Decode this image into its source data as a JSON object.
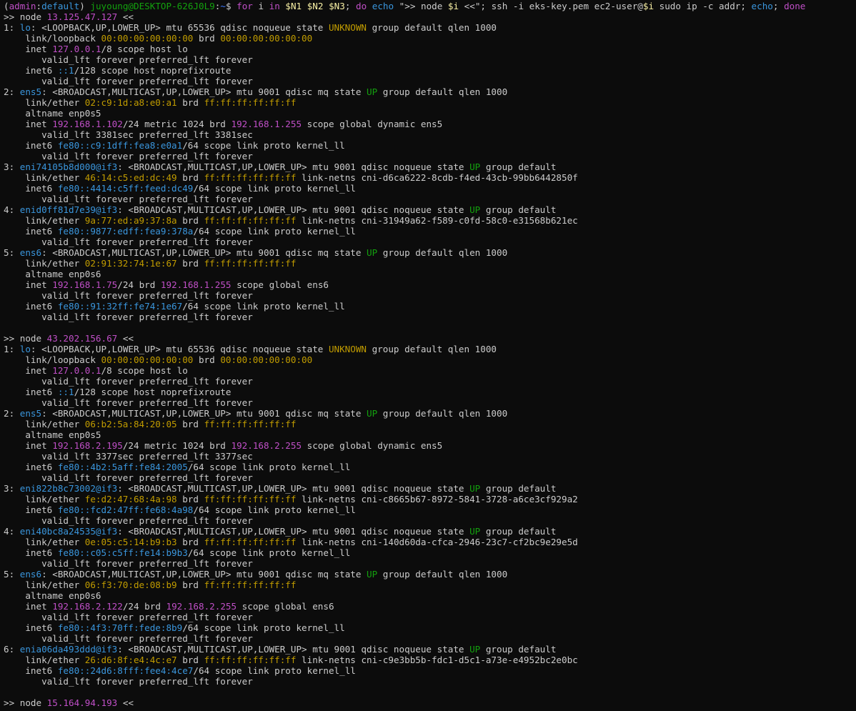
{
  "terminal": {
    "colors": {
      "background": "#0c0c0c",
      "text": "#cccccc",
      "cyan": "#3a96dd",
      "magenta": "#c04fc7",
      "yellow": "#c19c00",
      "green": "#13a10e",
      "bright_green": "#16c60c",
      "bright_blue": "#3b78ff",
      "bright_yellow": "#f9f1a5"
    },
    "lines": [
      [
        {
          "t": "(",
          "c": "text"
        },
        {
          "t": "admin",
          "c": "magenta"
        },
        {
          "t": ":",
          "c": "text"
        },
        {
          "t": "default",
          "c": "cyan"
        },
        {
          "t": ") ",
          "c": "text"
        },
        {
          "t": "juyoung@DESKTOP-626J0L9",
          "c": "green"
        },
        {
          "t": ":",
          "c": "text"
        },
        {
          "t": "~",
          "c": "bright_blue"
        },
        {
          "t": "$ ",
          "c": "text"
        },
        {
          "t": "for",
          "c": "magenta"
        },
        {
          "t": " i ",
          "c": "text"
        },
        {
          "t": "in",
          "c": "magenta"
        },
        {
          "t": " ",
          "c": "text"
        },
        {
          "t": "$N1",
          "c": "bright_yellow"
        },
        {
          "t": " ",
          "c": "text"
        },
        {
          "t": "$N2",
          "c": "bright_yellow"
        },
        {
          "t": " ",
          "c": "text"
        },
        {
          "t": "$N3",
          "c": "bright_yellow"
        },
        {
          "t": "; ",
          "c": "text"
        },
        {
          "t": "do",
          "c": "magenta"
        },
        {
          "t": " ",
          "c": "text"
        },
        {
          "t": "echo",
          "c": "cyan"
        },
        {
          "t": " \">> node ",
          "c": "text"
        },
        {
          "t": "$i",
          "c": "bright_yellow"
        },
        {
          "t": " <<\"; ssh -i eks-key.pem ec2-user@",
          "c": "text"
        },
        {
          "t": "$i",
          "c": "bright_yellow"
        },
        {
          "t": " sudo ip -c addr; ",
          "c": "text"
        },
        {
          "t": "echo",
          "c": "cyan"
        },
        {
          "t": "; ",
          "c": "text"
        },
        {
          "t": "done",
          "c": "magenta"
        }
      ],
      [
        {
          "t": ">> node ",
          "c": "text"
        },
        {
          "t": "13.125.47.127",
          "c": "magenta"
        },
        {
          "t": " <<",
          "c": "text"
        }
      ],
      [
        {
          "t": "1: ",
          "c": "text"
        },
        {
          "t": "lo",
          "c": "cyan"
        },
        {
          "t": ": <LOOPBACK,UP,LOWER_UP> mtu 65536 qdisc noqueue state ",
          "c": "text"
        },
        {
          "t": "UNKNOWN",
          "c": "yellow"
        },
        {
          "t": " group default qlen 1000",
          "c": "text"
        }
      ],
      [
        {
          "t": "    link/loopback ",
          "c": "text"
        },
        {
          "t": "00:00:00:00:00:00",
          "c": "yellow"
        },
        {
          "t": " brd ",
          "c": "text"
        },
        {
          "t": "00:00:00:00:00:00",
          "c": "yellow"
        }
      ],
      [
        {
          "t": "    inet ",
          "c": "text"
        },
        {
          "t": "127.0.0.1",
          "c": "magenta"
        },
        {
          "t": "/8 scope host lo",
          "c": "text"
        }
      ],
      [
        {
          "t": "       valid_lft forever preferred_lft forever",
          "c": "text"
        }
      ],
      [
        {
          "t": "    inet6 ",
          "c": "text"
        },
        {
          "t": "::1",
          "c": "cyan"
        },
        {
          "t": "/128 scope host noprefixroute",
          "c": "text"
        }
      ],
      [
        {
          "t": "       valid_lft forever preferred_lft forever",
          "c": "text"
        }
      ],
      [
        {
          "t": "2: ",
          "c": "text"
        },
        {
          "t": "ens5",
          "c": "cyan"
        },
        {
          "t": ": <BROADCAST,MULTICAST,UP,LOWER_UP> mtu 9001 qdisc mq state ",
          "c": "text"
        },
        {
          "t": "UP",
          "c": "green"
        },
        {
          "t": " group default qlen 1000",
          "c": "text"
        }
      ],
      [
        {
          "t": "    link/ether ",
          "c": "text"
        },
        {
          "t": "02:c9:1d:a8:e0:a1",
          "c": "yellow"
        },
        {
          "t": " brd ",
          "c": "text"
        },
        {
          "t": "ff:ff:ff:ff:ff:ff",
          "c": "yellow"
        }
      ],
      [
        {
          "t": "    altname enp0s5",
          "c": "text"
        }
      ],
      [
        {
          "t": "    inet ",
          "c": "text"
        },
        {
          "t": "192.168.1.102",
          "c": "magenta"
        },
        {
          "t": "/24 metric 1024 brd ",
          "c": "text"
        },
        {
          "t": "192.168.1.255",
          "c": "magenta"
        },
        {
          "t": " scope global dynamic ens5",
          "c": "text"
        }
      ],
      [
        {
          "t": "       valid_lft 3381sec preferred_lft 3381sec",
          "c": "text"
        }
      ],
      [
        {
          "t": "    inet6 ",
          "c": "text"
        },
        {
          "t": "fe80::c9:1dff:fea8:e0a1",
          "c": "cyan"
        },
        {
          "t": "/64 scope link proto kernel_ll",
          "c": "text"
        }
      ],
      [
        {
          "t": "       valid_lft forever preferred_lft forever",
          "c": "text"
        }
      ],
      [
        {
          "t": "3: ",
          "c": "text"
        },
        {
          "t": "eni74105b8d000@if3",
          "c": "cyan"
        },
        {
          "t": ": <BROADCAST,MULTICAST,UP,LOWER_UP> mtu 9001 qdisc noqueue state ",
          "c": "text"
        },
        {
          "t": "UP",
          "c": "green"
        },
        {
          "t": " group default",
          "c": "text"
        }
      ],
      [
        {
          "t": "    link/ether ",
          "c": "text"
        },
        {
          "t": "46:14:c5:ed:dc:49",
          "c": "yellow"
        },
        {
          "t": " brd ",
          "c": "text"
        },
        {
          "t": "ff:ff:ff:ff:ff:ff",
          "c": "yellow"
        },
        {
          "t": " link-netns cni-d6ca6222-8cdb-f4ed-43cb-99bb6442850f",
          "c": "text"
        }
      ],
      [
        {
          "t": "    inet6 ",
          "c": "text"
        },
        {
          "t": "fe80::4414:c5ff:feed:dc49",
          "c": "cyan"
        },
        {
          "t": "/64 scope link proto kernel_ll",
          "c": "text"
        }
      ],
      [
        {
          "t": "       valid_lft forever preferred_lft forever",
          "c": "text"
        }
      ],
      [
        {
          "t": "4: ",
          "c": "text"
        },
        {
          "t": "enid0ff81d7e39@if3",
          "c": "cyan"
        },
        {
          "t": ": <BROADCAST,MULTICAST,UP,LOWER_UP> mtu 9001 qdisc noqueue state ",
          "c": "text"
        },
        {
          "t": "UP",
          "c": "green"
        },
        {
          "t": " group default",
          "c": "text"
        }
      ],
      [
        {
          "t": "    link/ether ",
          "c": "text"
        },
        {
          "t": "9a:77:ed:a9:37:8a",
          "c": "yellow"
        },
        {
          "t": " brd ",
          "c": "text"
        },
        {
          "t": "ff:ff:ff:ff:ff:ff",
          "c": "yellow"
        },
        {
          "t": " link-netns cni-31949a62-f589-c0fd-58c0-e31568b621ec",
          "c": "text"
        }
      ],
      [
        {
          "t": "    inet6 ",
          "c": "text"
        },
        {
          "t": "fe80::9877:edff:fea9:378a",
          "c": "cyan"
        },
        {
          "t": "/64 scope link proto kernel_ll",
          "c": "text"
        }
      ],
      [
        {
          "t": "       valid_lft forever preferred_lft forever",
          "c": "text"
        }
      ],
      [
        {
          "t": "5: ",
          "c": "text"
        },
        {
          "t": "ens6",
          "c": "cyan"
        },
        {
          "t": ": <BROADCAST,MULTICAST,UP,LOWER_UP> mtu 9001 qdisc mq state ",
          "c": "text"
        },
        {
          "t": "UP",
          "c": "green"
        },
        {
          "t": " group default qlen 1000",
          "c": "text"
        }
      ],
      [
        {
          "t": "    link/ether ",
          "c": "text"
        },
        {
          "t": "02:91:32:74:1e:67",
          "c": "yellow"
        },
        {
          "t": " brd ",
          "c": "text"
        },
        {
          "t": "ff:ff:ff:ff:ff:ff",
          "c": "yellow"
        }
      ],
      [
        {
          "t": "    altname enp0s6",
          "c": "text"
        }
      ],
      [
        {
          "t": "    inet ",
          "c": "text"
        },
        {
          "t": "192.168.1.75",
          "c": "magenta"
        },
        {
          "t": "/24 brd ",
          "c": "text"
        },
        {
          "t": "192.168.1.255",
          "c": "magenta"
        },
        {
          "t": " scope global ens6",
          "c": "text"
        }
      ],
      [
        {
          "t": "       valid_lft forever preferred_lft forever",
          "c": "text"
        }
      ],
      [
        {
          "t": "    inet6 ",
          "c": "text"
        },
        {
          "t": "fe80::91:32ff:fe74:1e67",
          "c": "cyan"
        },
        {
          "t": "/64 scope link proto kernel_ll",
          "c": "text"
        }
      ],
      [
        {
          "t": "       valid_lft forever preferred_lft forever",
          "c": "text"
        }
      ],
      [],
      [
        {
          "t": ">> node ",
          "c": "text"
        },
        {
          "t": "43.202.156.67",
          "c": "magenta"
        },
        {
          "t": " <<",
          "c": "text"
        }
      ],
      [
        {
          "t": "1: ",
          "c": "text"
        },
        {
          "t": "lo",
          "c": "cyan"
        },
        {
          "t": ": <LOOPBACK,UP,LOWER_UP> mtu 65536 qdisc noqueue state ",
          "c": "text"
        },
        {
          "t": "UNKNOWN",
          "c": "yellow"
        },
        {
          "t": " group default qlen 1000",
          "c": "text"
        }
      ],
      [
        {
          "t": "    link/loopback ",
          "c": "text"
        },
        {
          "t": "00:00:00:00:00:00",
          "c": "yellow"
        },
        {
          "t": " brd ",
          "c": "text"
        },
        {
          "t": "00:00:00:00:00:00",
          "c": "yellow"
        }
      ],
      [
        {
          "t": "    inet ",
          "c": "text"
        },
        {
          "t": "127.0.0.1",
          "c": "magenta"
        },
        {
          "t": "/8 scope host lo",
          "c": "text"
        }
      ],
      [
        {
          "t": "       valid_lft forever preferred_lft forever",
          "c": "text"
        }
      ],
      [
        {
          "t": "    inet6 ",
          "c": "text"
        },
        {
          "t": "::1",
          "c": "cyan"
        },
        {
          "t": "/128 scope host noprefixroute",
          "c": "text"
        }
      ],
      [
        {
          "t": "       valid_lft forever preferred_lft forever",
          "c": "text"
        }
      ],
      [
        {
          "t": "2: ",
          "c": "text"
        },
        {
          "t": "ens5",
          "c": "cyan"
        },
        {
          "t": ": <BROADCAST,MULTICAST,UP,LOWER_UP> mtu 9001 qdisc mq state ",
          "c": "text"
        },
        {
          "t": "UP",
          "c": "green"
        },
        {
          "t": " group default qlen 1000",
          "c": "text"
        }
      ],
      [
        {
          "t": "    link/ether ",
          "c": "text"
        },
        {
          "t": "06:b2:5a:84:20:05",
          "c": "yellow"
        },
        {
          "t": " brd ",
          "c": "text"
        },
        {
          "t": "ff:ff:ff:ff:ff:ff",
          "c": "yellow"
        }
      ],
      [
        {
          "t": "    altname enp0s5",
          "c": "text"
        }
      ],
      [
        {
          "t": "    inet ",
          "c": "text"
        },
        {
          "t": "192.168.2.195",
          "c": "magenta"
        },
        {
          "t": "/24 metric 1024 brd ",
          "c": "text"
        },
        {
          "t": "192.168.2.255",
          "c": "magenta"
        },
        {
          "t": " scope global dynamic ens5",
          "c": "text"
        }
      ],
      [
        {
          "t": "       valid_lft 3377sec preferred_lft 3377sec",
          "c": "text"
        }
      ],
      [
        {
          "t": "    inet6 ",
          "c": "text"
        },
        {
          "t": "fe80::4b2:5aff:fe84:2005",
          "c": "cyan"
        },
        {
          "t": "/64 scope link proto kernel_ll",
          "c": "text"
        }
      ],
      [
        {
          "t": "       valid_lft forever preferred_lft forever",
          "c": "text"
        }
      ],
      [
        {
          "t": "3: ",
          "c": "text"
        },
        {
          "t": "eni822b8c73002@if3",
          "c": "cyan"
        },
        {
          "t": ": <BROADCAST,MULTICAST,UP,LOWER_UP> mtu 9001 qdisc noqueue state ",
          "c": "text"
        },
        {
          "t": "UP",
          "c": "green"
        },
        {
          "t": " group default",
          "c": "text"
        }
      ],
      [
        {
          "t": "    link/ether ",
          "c": "text"
        },
        {
          "t": "fe:d2:47:68:4a:98",
          "c": "yellow"
        },
        {
          "t": " brd ",
          "c": "text"
        },
        {
          "t": "ff:ff:ff:ff:ff:ff",
          "c": "yellow"
        },
        {
          "t": " link-netns cni-c8665b67-8972-5841-3728-a6ce3cf929a2",
          "c": "text"
        }
      ],
      [
        {
          "t": "    inet6 ",
          "c": "text"
        },
        {
          "t": "fe80::fcd2:47ff:fe68:4a98",
          "c": "cyan"
        },
        {
          "t": "/64 scope link proto kernel_ll",
          "c": "text"
        }
      ],
      [
        {
          "t": "       valid_lft forever preferred_lft forever",
          "c": "text"
        }
      ],
      [
        {
          "t": "4: ",
          "c": "text"
        },
        {
          "t": "eni40bc8a24535@if3",
          "c": "cyan"
        },
        {
          "t": ": <BROADCAST,MULTICAST,UP,LOWER_UP> mtu 9001 qdisc noqueue state ",
          "c": "text"
        },
        {
          "t": "UP",
          "c": "green"
        },
        {
          "t": " group default",
          "c": "text"
        }
      ],
      [
        {
          "t": "    link/ether ",
          "c": "text"
        },
        {
          "t": "0e:05:c5:14:b9:b3",
          "c": "yellow"
        },
        {
          "t": " brd ",
          "c": "text"
        },
        {
          "t": "ff:ff:ff:ff:ff:ff",
          "c": "yellow"
        },
        {
          "t": " link-netns cni-140d60da-cfca-2946-23c7-cf2bc9e29e5d",
          "c": "text"
        }
      ],
      [
        {
          "t": "    inet6 ",
          "c": "text"
        },
        {
          "t": "fe80::c05:c5ff:fe14:b9b3",
          "c": "cyan"
        },
        {
          "t": "/64 scope link proto kernel_ll",
          "c": "text"
        }
      ],
      [
        {
          "t": "       valid_lft forever preferred_lft forever",
          "c": "text"
        }
      ],
      [
        {
          "t": "5: ",
          "c": "text"
        },
        {
          "t": "ens6",
          "c": "cyan"
        },
        {
          "t": ": <BROADCAST,MULTICAST,UP,LOWER_UP> mtu 9001 qdisc mq state ",
          "c": "text"
        },
        {
          "t": "UP",
          "c": "green"
        },
        {
          "t": " group default qlen 1000",
          "c": "text"
        }
      ],
      [
        {
          "t": "    link/ether ",
          "c": "text"
        },
        {
          "t": "06:f3:70:de:08:b9",
          "c": "yellow"
        },
        {
          "t": " brd ",
          "c": "text"
        },
        {
          "t": "ff:ff:ff:ff:ff:ff",
          "c": "yellow"
        }
      ],
      [
        {
          "t": "    altname enp0s6",
          "c": "text"
        }
      ],
      [
        {
          "t": "    inet ",
          "c": "text"
        },
        {
          "t": "192.168.2.122",
          "c": "magenta"
        },
        {
          "t": "/24 brd ",
          "c": "text"
        },
        {
          "t": "192.168.2.255",
          "c": "magenta"
        },
        {
          "t": " scope global ens6",
          "c": "text"
        }
      ],
      [
        {
          "t": "       valid_lft forever preferred_lft forever",
          "c": "text"
        }
      ],
      [
        {
          "t": "    inet6 ",
          "c": "text"
        },
        {
          "t": "fe80::4f3:70ff:fede:8b9",
          "c": "cyan"
        },
        {
          "t": "/64 scope link proto kernel_ll",
          "c": "text"
        }
      ],
      [
        {
          "t": "       valid_lft forever preferred_lft forever",
          "c": "text"
        }
      ],
      [
        {
          "t": "6: ",
          "c": "text"
        },
        {
          "t": "enia06da493ddd@if3",
          "c": "cyan"
        },
        {
          "t": ": <BROADCAST,MULTICAST,UP,LOWER_UP> mtu 9001 qdisc noqueue state ",
          "c": "text"
        },
        {
          "t": "UP",
          "c": "green"
        },
        {
          "t": " group default",
          "c": "text"
        }
      ],
      [
        {
          "t": "    link/ether ",
          "c": "text"
        },
        {
          "t": "26:d6:8f:e4:4c:e7",
          "c": "yellow"
        },
        {
          "t": " brd ",
          "c": "text"
        },
        {
          "t": "ff:ff:ff:ff:ff:ff",
          "c": "yellow"
        },
        {
          "t": " link-netns cni-c9e3bb5b-fdc1-d5c1-a73e-e4952bc2e0bc",
          "c": "text"
        }
      ],
      [
        {
          "t": "    inet6 ",
          "c": "text"
        },
        {
          "t": "fe80::24d6:8fff:fee4:4ce7",
          "c": "cyan"
        },
        {
          "t": "/64 scope link proto kernel_ll",
          "c": "text"
        }
      ],
      [
        {
          "t": "       valid_lft forever preferred_lft forever",
          "c": "text"
        }
      ],
      [],
      [
        {
          "t": ">> node ",
          "c": "text"
        },
        {
          "t": "15.164.94.193",
          "c": "magenta"
        },
        {
          "t": " <<",
          "c": "text"
        }
      ]
    ]
  }
}
